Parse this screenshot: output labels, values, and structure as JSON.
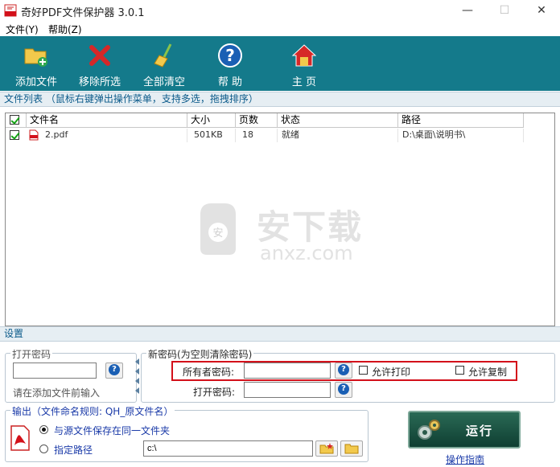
{
  "window": {
    "title": "奇好PDF文件保护器 3.0.1",
    "min_glyph": "—",
    "max_glyph": "☐",
    "close_glyph": "✕"
  },
  "menu": [
    "文件(Y)",
    "帮助(Z)"
  ],
  "toolbar": [
    {
      "label": "添加文件",
      "icon": "add-folder-icon"
    },
    {
      "label": "移除所选",
      "icon": "remove-x-icon"
    },
    {
      "label": "全部清空",
      "icon": "broom-icon"
    },
    {
      "label": "帮 助",
      "icon": "help-icon"
    },
    {
      "label": "主 页",
      "icon": "home-icon"
    }
  ],
  "file_list": {
    "section_label": "文件列表  （鼠标右键弹出操作菜单，支持多选，拖拽排序）",
    "columns": [
      "文件名",
      "大小",
      "页数",
      "状态",
      "路径"
    ],
    "rows": [
      {
        "checked": true,
        "name": "2.pdf",
        "size": "501KB",
        "pages": "18",
        "status": "就绪",
        "path": "D:\\桌面\\说明书\\"
      }
    ]
  },
  "watermark": {
    "brand": "安下载",
    "domain": "anxz.com"
  },
  "settings": {
    "section_label": "设置",
    "open_password": {
      "title": "打开密码",
      "value": "",
      "hint": "请在添加文件前输入"
    },
    "new_password": {
      "title": "新密码(为空则清除密码)",
      "owner_label": "所有者密码:",
      "owner_value": "",
      "open_label": "打开密码:",
      "open_value": "",
      "allow_print": "允许打印",
      "allow_print_checked": false,
      "allow_copy": "允许复制",
      "allow_copy_checked": false
    },
    "output": {
      "title": "输出（文件命名规则: QH_原文件名）",
      "option_same": "与源文件保存在同一文件夹",
      "option_custom": "指定路径",
      "selected": "same",
      "path_value": "c:\\"
    }
  },
  "run_label": "运行",
  "guide_label": "操作指南",
  "colors": {
    "toolbar": "#147a8b",
    "section_text": "#0b5a8a",
    "highlight": "#d3101a",
    "run_button": "#1f5444"
  }
}
